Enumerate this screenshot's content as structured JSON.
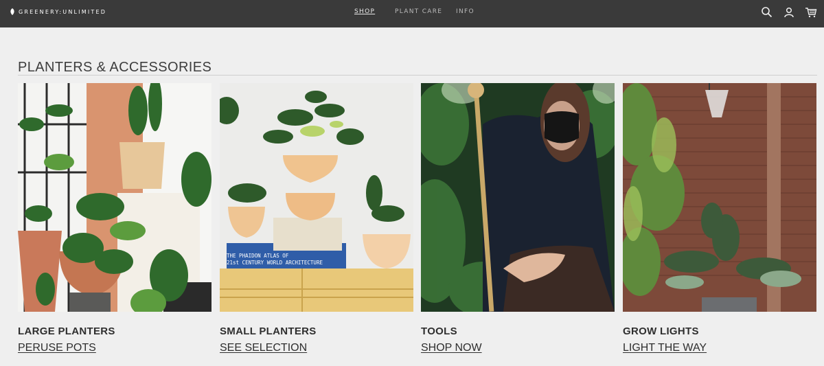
{
  "header": {
    "logo": "GREENERY:UNLIMITED",
    "nav": [
      {
        "label": "SHOP",
        "active": true
      },
      {
        "label": "PLANT CARE",
        "active": false
      },
      {
        "label": "INFO",
        "active": false
      }
    ],
    "icons": [
      "search-icon",
      "account-icon",
      "cart-icon"
    ]
  },
  "main": {
    "section_title": "PLANTERS & ACCESSORIES",
    "cards": [
      {
        "category": "LARGE PLANTERS",
        "cta": "PERUSE POTS"
      },
      {
        "category": "SMALL PLANTERS",
        "cta": "SEE SELECTION",
        "book_text_1": "THE PHAIDON ATLAS OF",
        "book_text_2": "21st CENTURY WORLD ARCHITECTURE"
      },
      {
        "category": "TOOLS",
        "cta": "SHOP NOW"
      },
      {
        "category": "GROW LIGHTS",
        "cta": "LIGHT THE WAY"
      }
    ]
  },
  "colors": {
    "topbar": "#3a3a3a",
    "page_bg": "#efefef",
    "text": "#2e2e2e"
  }
}
